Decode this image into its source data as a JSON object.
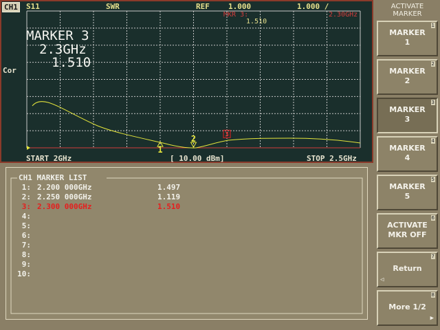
{
  "header": {
    "channel": "CH1",
    "parameter": "S11",
    "format": "SWR",
    "ref_label": "REF",
    "ref_value": "1.000",
    "scale": "1.000 /"
  },
  "marker_annotation": {
    "label": "MKR 3:",
    "value": "1.510",
    "freq_short": "2.30GHz"
  },
  "active_marker_readout": {
    "title": "MARKER 3",
    "frequency": "2.3GHz",
    "value": "1.510"
  },
  "side_label": "Cor",
  "footer": {
    "start": "START 2GHz",
    "power": "[ 10.00 dBm]",
    "stop": "STOP 2.5GHz"
  },
  "trace_markers": [
    {
      "label": "1",
      "freq_ghz": 2.2,
      "value": 1.497
    },
    {
      "label": "2",
      "freq_ghz": 2.25,
      "value": 1.119
    },
    {
      "label": "3",
      "freq_ghz": 2.3,
      "value": 1.51
    }
  ],
  "marker_list": {
    "title": "CH1 MARKER LIST",
    "rows": [
      {
        "index": "1:",
        "freq": "2.200 000GHz",
        "value": "1.497"
      },
      {
        "index": "2:",
        "freq": "2.250 000GHz",
        "value": "1.119"
      },
      {
        "index": "3:",
        "freq": "2.300 000GHz",
        "value": "1.510"
      },
      {
        "index": "4:",
        "freq": "",
        "value": ""
      },
      {
        "index": "5:",
        "freq": "",
        "value": ""
      },
      {
        "index": "6:",
        "freq": "",
        "value": ""
      },
      {
        "index": "7:",
        "freq": "",
        "value": ""
      },
      {
        "index": "8:",
        "freq": "",
        "value": ""
      },
      {
        "index": "9:",
        "freq": "",
        "value": ""
      },
      {
        "index": "10:",
        "freq": "",
        "value": ""
      }
    ]
  },
  "softkeys": {
    "title": "ACTIVATE\nMARKER",
    "keys": [
      {
        "label": "MARKER\n1",
        "num": "1"
      },
      {
        "label": "MARKER\n2",
        "num": "2"
      },
      {
        "label": "MARKER\n3",
        "num": "3"
      },
      {
        "label": "MARKER\n4",
        "num": "4"
      },
      {
        "label": "MARKER\n5",
        "num": "5"
      },
      {
        "label": "ACTIVATE\nMKR OFF",
        "num": "6"
      },
      {
        "label": "Return",
        "num": "7"
      },
      {
        "label": "More 1/2",
        "num": "8"
      }
    ]
  },
  "colors": {
    "trace": "#e6e63c",
    "grid": "#c8c8c8",
    "marker_active": "#e61e1e",
    "reference_line": "#d23c3c"
  }
}
